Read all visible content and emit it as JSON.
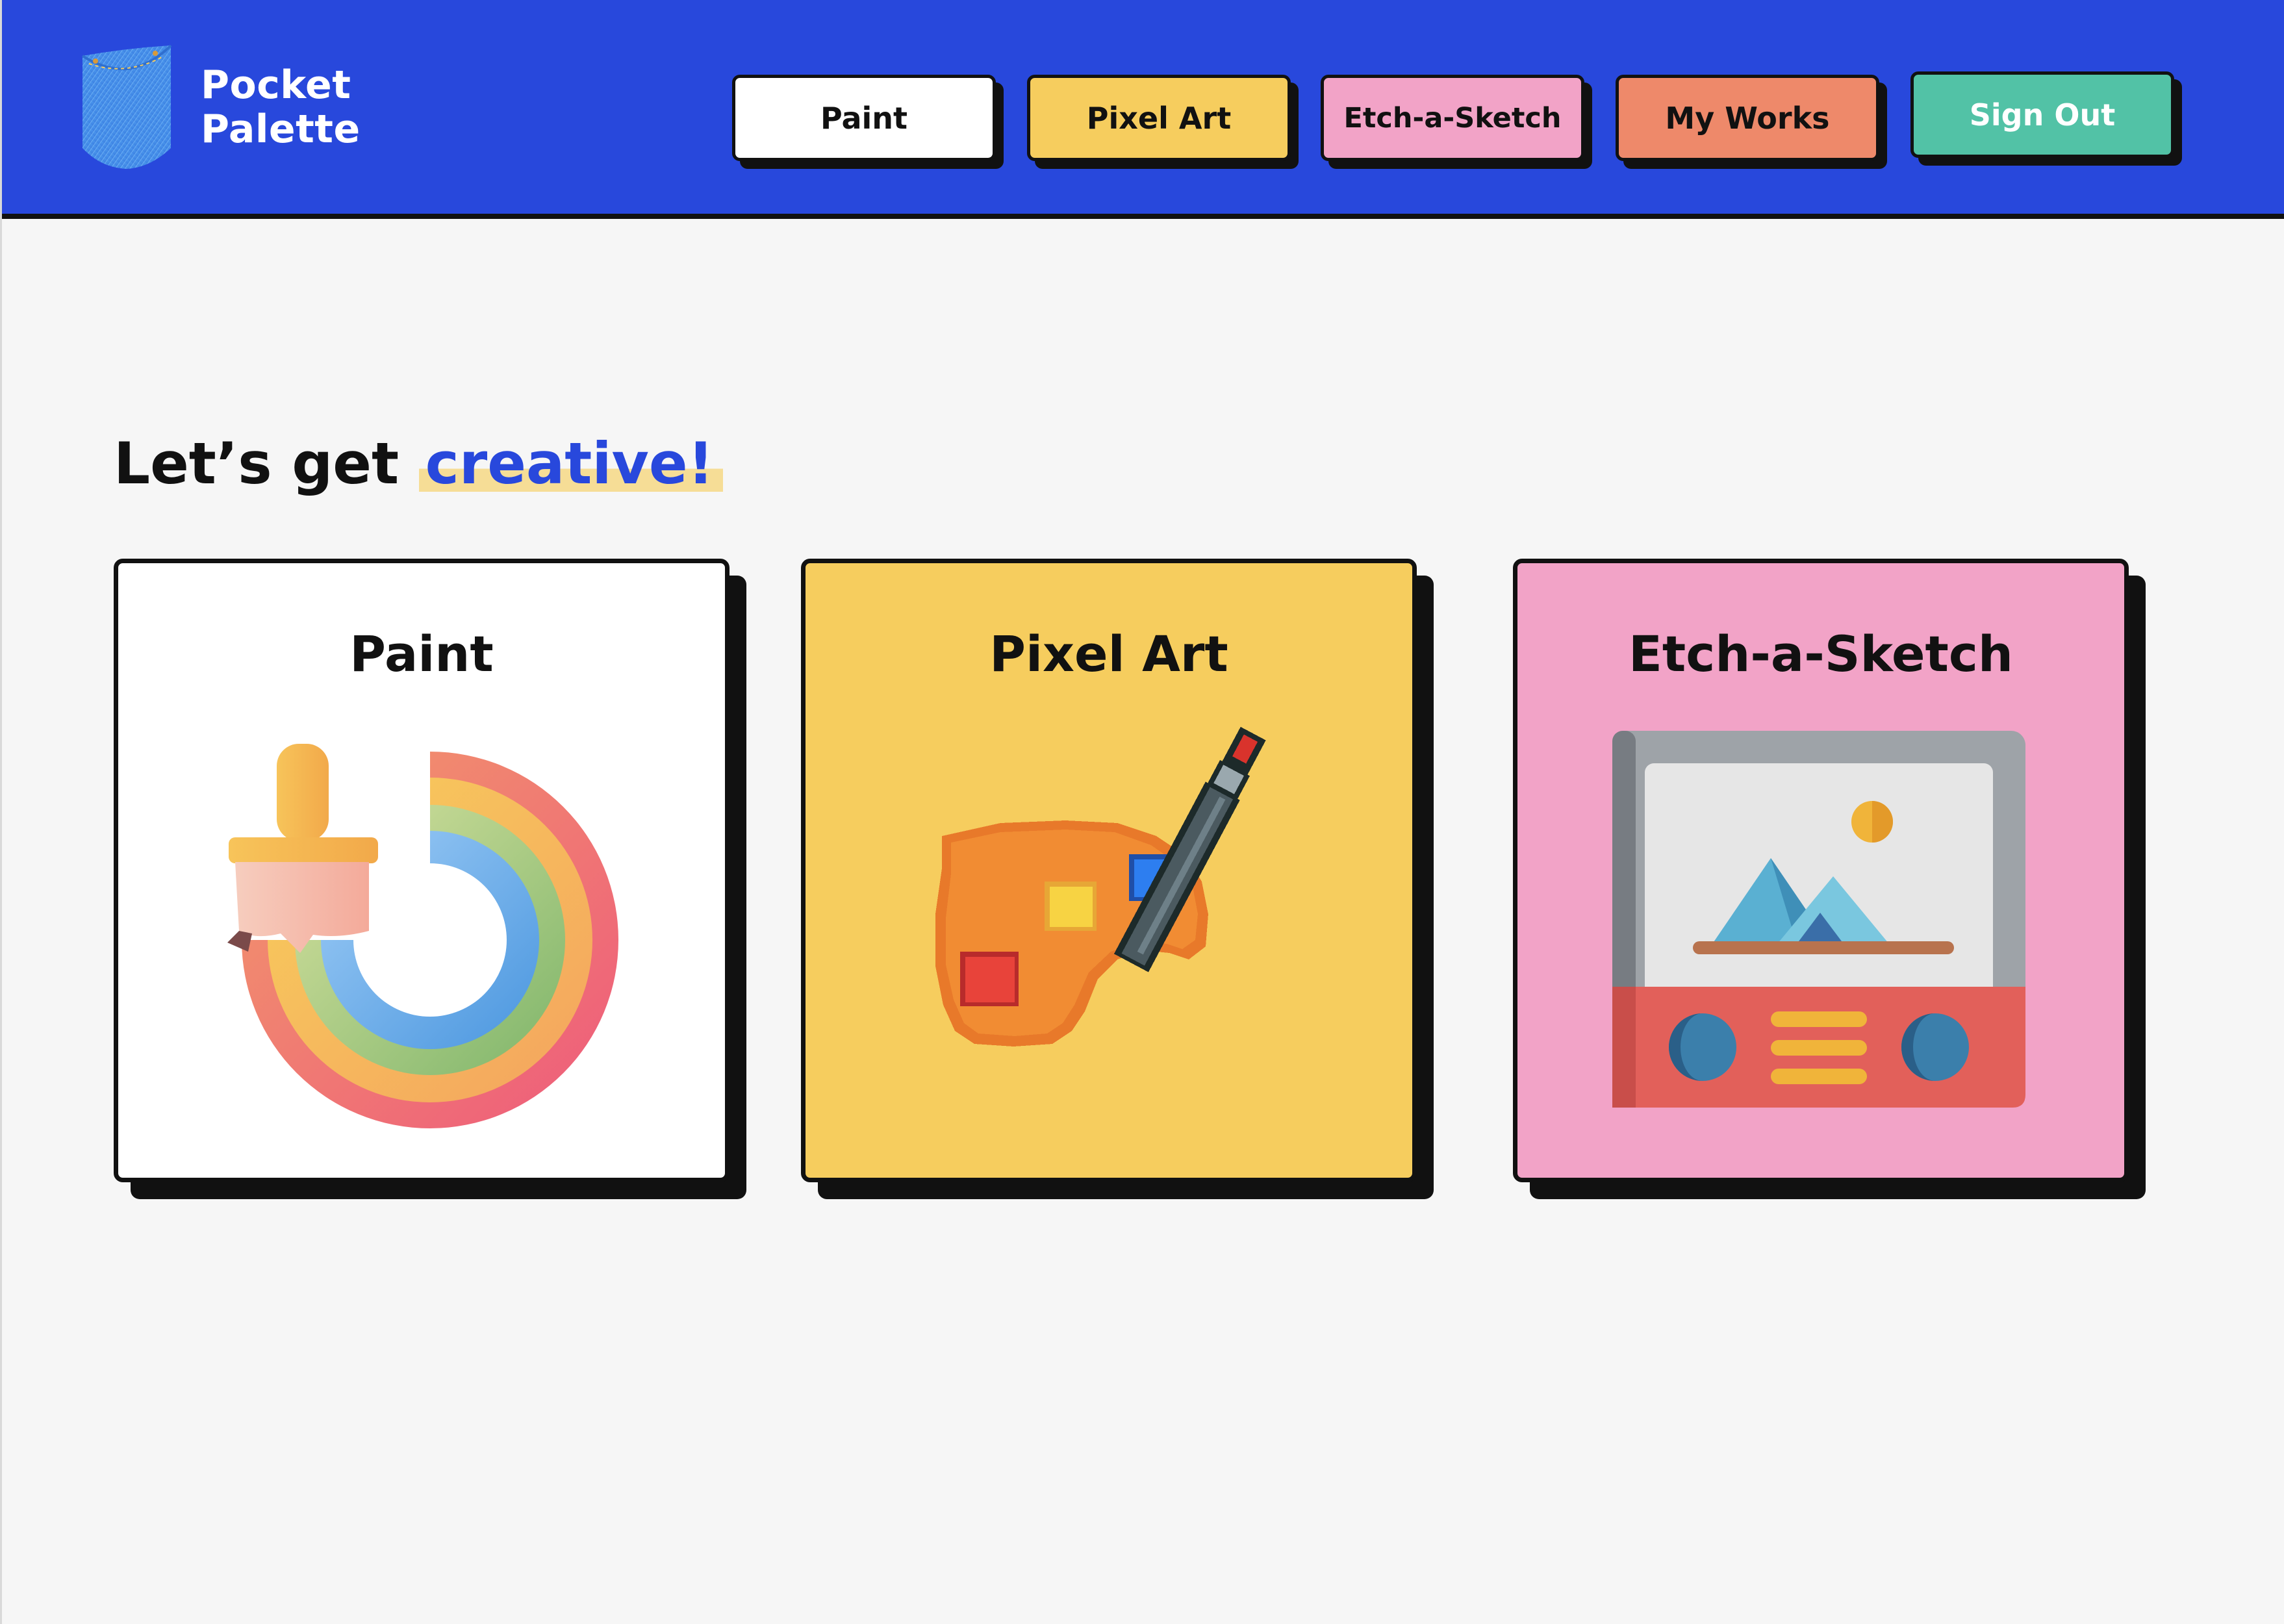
{
  "brand": {
    "line1": "Pocket",
    "line2": "Palette",
    "icon": "pocket-icon"
  },
  "nav": {
    "paint": "Paint",
    "pixel_art": "Pixel Art",
    "etch": "Etch-a-Sketch",
    "my_works": "My Works",
    "sign_out": "Sign Out"
  },
  "heading": {
    "prefix": "Let’s get ",
    "accent": "creative!"
  },
  "cards": [
    {
      "title": "Paint",
      "icon": "paintbrush-rainbow-icon",
      "color": "#ffffff"
    },
    {
      "title": "Pixel Art",
      "icon": "pixel-palette-icon",
      "color": "#f6cd5e"
    },
    {
      "title": "Etch-a-Sketch",
      "icon": "etch-a-sketch-icon",
      "color": "#f2a3c7"
    }
  ],
  "colors": {
    "header": "#2848dc",
    "paint": "#ffffff",
    "pixel_art": "#f6cd5e",
    "etch": "#f2a3c7",
    "my_works": "#ee896a",
    "sign_out": "#52c2a6"
  }
}
